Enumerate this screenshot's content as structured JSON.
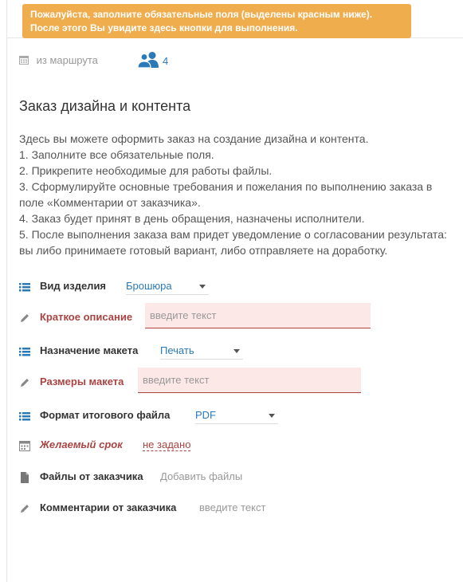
{
  "alert": {
    "line1": "Пожалуйста, заполните обязательные поля (выделены красным ниже).",
    "line2": "После этого Вы увидите здесь кнопки для выполнения."
  },
  "meta": {
    "route_label": "из маршрута",
    "participants_count": "4"
  },
  "title": "Заказ дизайна и контента",
  "description": [
    "Здесь вы можете оформить заказ на создание дизайна и контента.",
    "1. Заполните все обязательные поля.",
    "2. Прикрепите необходимые для работы файлы.",
    "3. Сформулируйте основные требования и пожелания по выполнению заказа в",
    "поле «Комментарии от заказчика».",
    "4. Заказ будет принят в день обращения, назначены исполнители.",
    "5. После выполнения заказа вам придет уведомление о согласовании результата:",
    "вы либо принимаете готовый вариант, либо отправляете на доработку."
  ],
  "fields": {
    "product_type": {
      "label": "Вид изделия",
      "value": "Брошюра"
    },
    "short_desc": {
      "label": "Краткое описание",
      "placeholder": "введите текст"
    },
    "layout_purpose": {
      "label": "Назначение макета",
      "value": "Печать"
    },
    "layout_size": {
      "label": "Размеры макета",
      "placeholder": "введите текст"
    },
    "file_format": {
      "label": "Формат итогового файла",
      "value": "PDF"
    },
    "deadline": {
      "label": "Желаемый срок",
      "value": "не задано"
    },
    "customer_files": {
      "label": "Файлы от заказчика",
      "action": "Добавить файлы"
    },
    "customer_comments": {
      "label": "Комментарии от заказчика",
      "placeholder": "введите текст"
    }
  },
  "icons": {
    "list": "list-icon",
    "pencil": "pencil-icon",
    "calendar": "calendar-icon",
    "file": "file-icon",
    "users": "users-icon"
  },
  "colors": {
    "alert_bg": "#f0ad4e",
    "required": "#a94442",
    "link": "#2a7ab8",
    "required_input_bg": "#fde8e8"
  }
}
